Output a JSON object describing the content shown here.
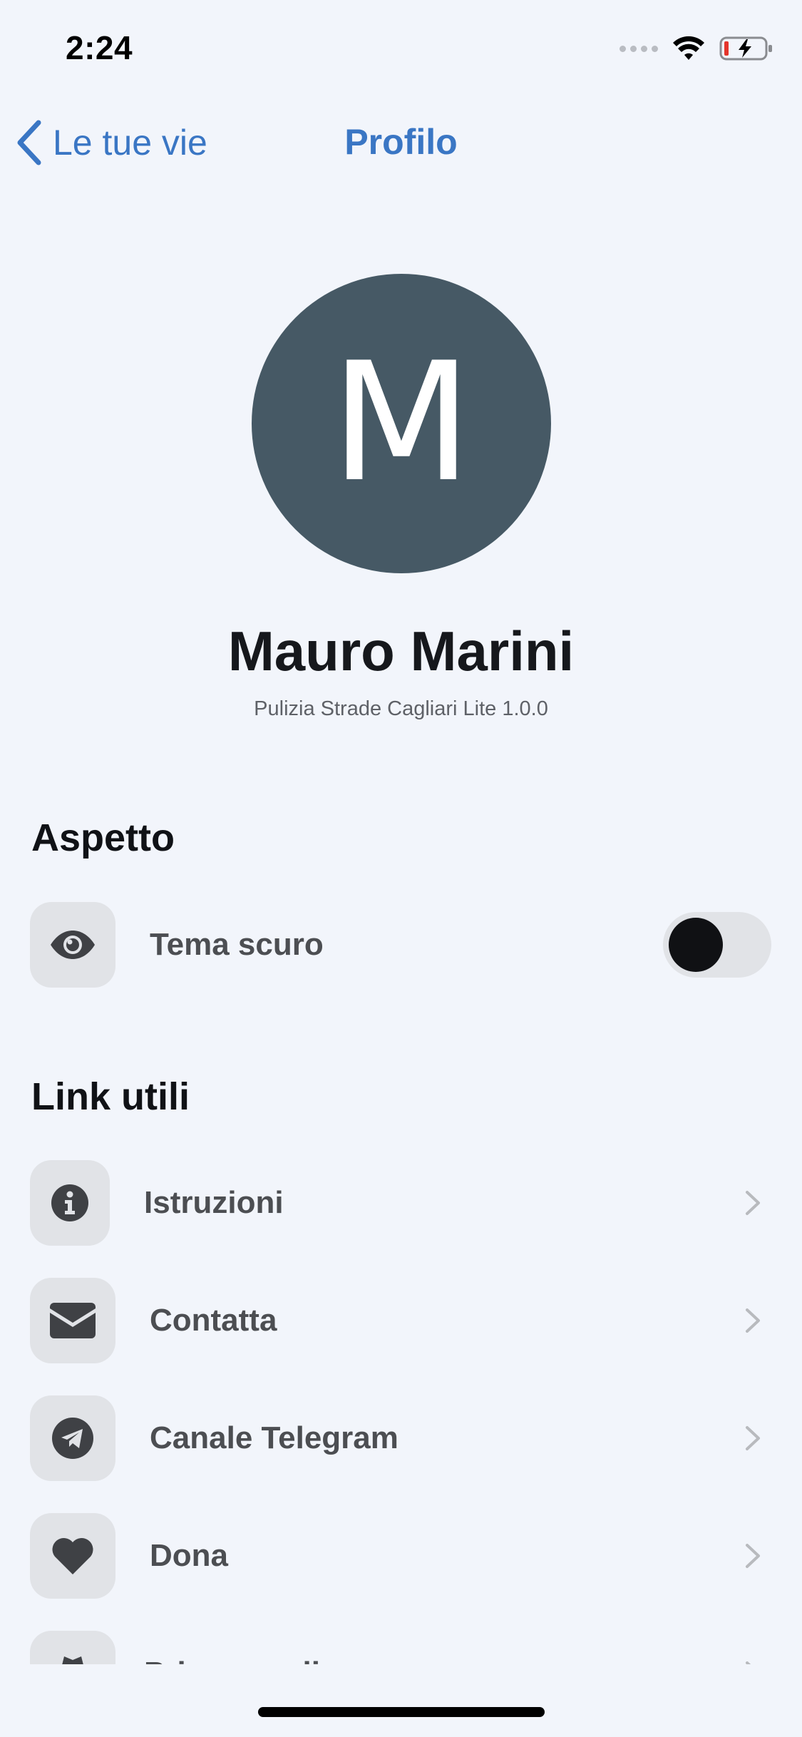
{
  "status_bar": {
    "time": "2:24"
  },
  "nav": {
    "back_label": "Le tue vie",
    "title": "Profilo"
  },
  "profile": {
    "avatar_initial": "M",
    "avatar_color": "#465965",
    "name": "Mauro Marini",
    "app_version": "Pulizia Strade Cagliari Lite 1.0.0"
  },
  "sections": {
    "appearance": {
      "title": "Aspetto",
      "dark_theme": {
        "label": "Tema scuro",
        "icon": "eye-icon",
        "enabled": false
      }
    },
    "links": {
      "title": "Link utili",
      "items": [
        {
          "label": "Istruzioni",
          "icon": "info-icon"
        },
        {
          "label": "Contatta",
          "icon": "envelope-icon"
        },
        {
          "label": "Canale Telegram",
          "icon": "telegram-icon"
        },
        {
          "label": "Dona",
          "icon": "heart-icon"
        },
        {
          "label": "Privacy policy",
          "icon": "user-secret-icon"
        }
      ]
    }
  },
  "colors": {
    "accent": "#3a76c4",
    "background": "#f2f5fb",
    "icon_box": "#e1e3e7",
    "label": "#4c4e52"
  }
}
